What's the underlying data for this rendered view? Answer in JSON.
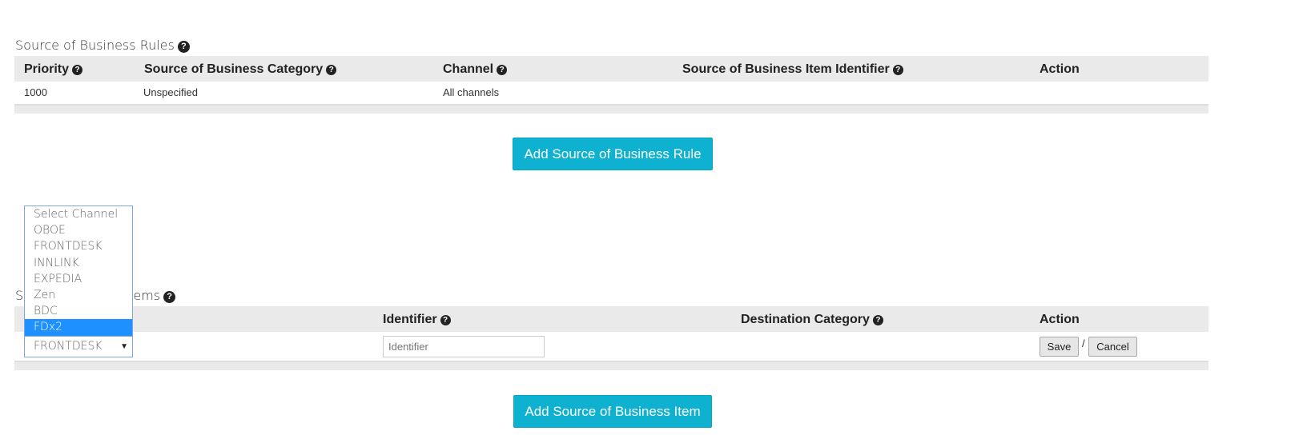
{
  "rules_section": {
    "title": "Source of Business Rules",
    "columns": {
      "priority": "Priority",
      "category": "Source of Business Category",
      "channel": "Channel",
      "identifier": "Source of Business Item Identifier",
      "action": "Action"
    },
    "rows": [
      {
        "priority": "1000",
        "category": "Unspecified",
        "channel": "All channels",
        "identifier": "",
        "action": ""
      }
    ],
    "add_button": "Add Source of Business Rule"
  },
  "items_section": {
    "title_visible_start": "So",
    "title_visible_end": "s Items",
    "columns": {
      "identifier": "Identifier",
      "destination": "Destination Category",
      "action": "Action"
    },
    "edit_row": {
      "channel_selected": "FRONTDESK",
      "identifier_placeholder": "Identifier",
      "save_label": "Save",
      "separator": "/",
      "cancel_label": "Cancel"
    },
    "add_button": "Add Source of Business Item"
  },
  "channel_dropdown": {
    "options": [
      "Select Channel",
      "OBOE",
      "FRONTDESK",
      "INNLINK",
      "EXPEDIA",
      "Zen",
      "BDC",
      "FDx2"
    ],
    "highlighted": "FDx2"
  },
  "icons": {
    "help": "?"
  },
  "colors": {
    "primary_button": "#0fb1d1",
    "header_bg": "#eaeaea",
    "dropdown_highlight": "#1e90ff"
  }
}
